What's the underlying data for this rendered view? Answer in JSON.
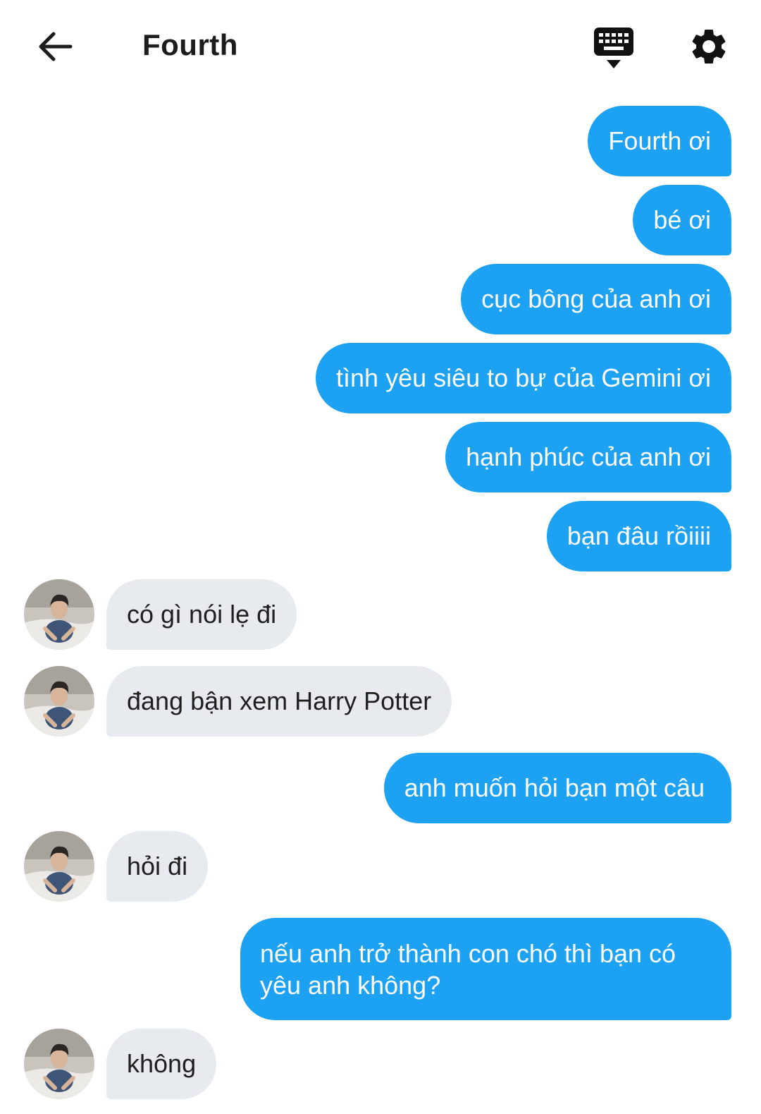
{
  "header": {
    "title": "Fourth",
    "back_icon": "arrow-left-icon",
    "keyboard_icon": "keyboard-hide-icon",
    "settings_icon": "gear-icon"
  },
  "colors": {
    "outgoing_bubble": "#1da1f2",
    "incoming_bubble": "#e7ebef"
  },
  "messages": [
    {
      "sender": "me",
      "text": "Fourth ơi"
    },
    {
      "sender": "me",
      "text": "bé ơi"
    },
    {
      "sender": "me",
      "text": "cục bông của anh ơi"
    },
    {
      "sender": "me",
      "text": "tình yêu siêu to bự của Gemini ơi"
    },
    {
      "sender": "me",
      "text": "hạnh phúc của anh ơi"
    },
    {
      "sender": "me",
      "text": "bạn đâu rồiiii"
    },
    {
      "sender": "contact",
      "text": "có gì nói lẹ đi"
    },
    {
      "sender": "contact",
      "text": "đang bận xem Harry Potter"
    },
    {
      "sender": "me",
      "text": "anh muốn hỏi bạn một câu"
    },
    {
      "sender": "contact",
      "text": "hỏi đi"
    },
    {
      "sender": "me",
      "text": "nếu anh trở thành con chó thì bạn có yêu anh không?"
    },
    {
      "sender": "contact",
      "text": "không"
    }
  ]
}
